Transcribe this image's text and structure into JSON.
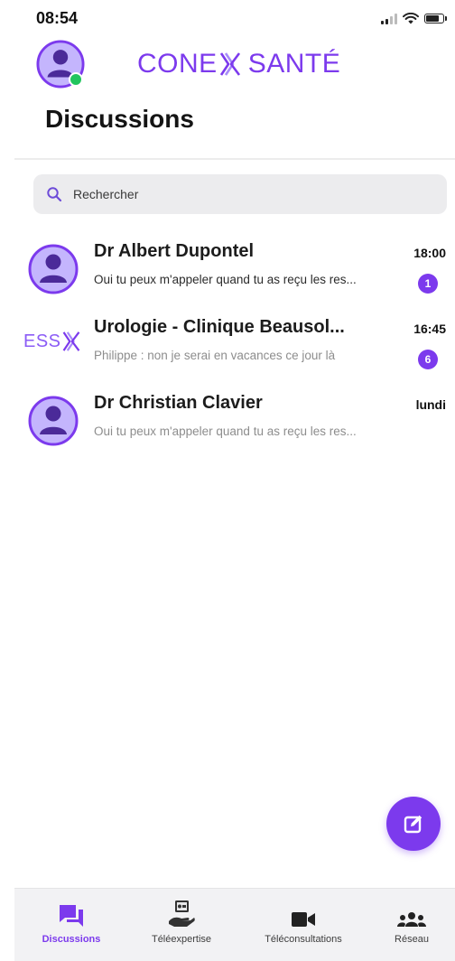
{
  "status_bar": {
    "time": "08:54"
  },
  "header": {
    "brand_left": "CONE",
    "brand_right": "SANTÉ",
    "title": "Discussions"
  },
  "search": {
    "placeholder": "Rechercher"
  },
  "conversations": [
    {
      "name": "Dr Albert Dupontel",
      "preview": "Oui tu peux m'appeler quand tu as reçu les res...",
      "time": "18:00",
      "unread": "1",
      "avatar": "person-icon"
    },
    {
      "name": "Urologie - Clinique Beausol...",
      "preview": "Philippe : non je serai en vacances ce jour là",
      "time": "16:45",
      "unread": "6",
      "avatar": "ess-logo",
      "logo_text": "ESS"
    },
    {
      "name": "Dr Christian Clavier",
      "preview": "Oui tu peux m'appeler quand tu as reçu les res...",
      "time": "lundi",
      "avatar": "person-icon"
    }
  ],
  "bottom_nav": [
    {
      "label": "Discussions",
      "icon": "chat-icon",
      "active": true
    },
    {
      "label": "Téléexpertise",
      "icon": "expertise-hand-icon",
      "active": false
    },
    {
      "label": "Téléconsultations",
      "icon": "video-camera-icon",
      "active": false
    },
    {
      "label": "Réseau",
      "icon": "group-icon",
      "active": false
    }
  ],
  "colors": {
    "accent": "#7c3aed",
    "avatar_bg": "#c4b5fd",
    "online": "#22c55e"
  },
  "icons": {
    "compose": "edit-square-icon",
    "search": "search-icon",
    "profile": "person-icon"
  }
}
